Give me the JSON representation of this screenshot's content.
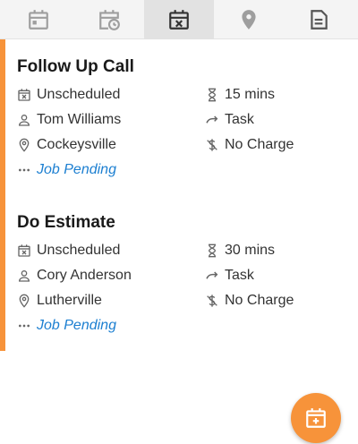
{
  "tabs": [
    {
      "icon": "calendar-icon",
      "active": false
    },
    {
      "icon": "calendar-clock-icon",
      "active": false
    },
    {
      "icon": "calendar-unscheduled-icon",
      "active": true
    },
    {
      "icon": "location-pin-icon",
      "active": false
    },
    {
      "icon": "document-icon",
      "active": false
    }
  ],
  "jobs": [
    {
      "title": "Follow Up Call",
      "schedule": "Unscheduled",
      "duration": "15 mins",
      "person": "Tom Williams",
      "type": "Task",
      "location": "Cockeysville",
      "charge": "No Charge",
      "status": "Job Pending"
    },
    {
      "title": "Do Estimate",
      "schedule": "Unscheduled",
      "duration": "30 mins",
      "person": "Cory Anderson",
      "type": "Task",
      "location": "Lutherville",
      "charge": "No Charge",
      "status": "Job Pending"
    }
  ],
  "colors": {
    "accent": "#f7933a",
    "link": "#1c7fd1",
    "active_tab": "#e2e2e2"
  },
  "fab": {
    "icon": "add-calendar-icon"
  }
}
